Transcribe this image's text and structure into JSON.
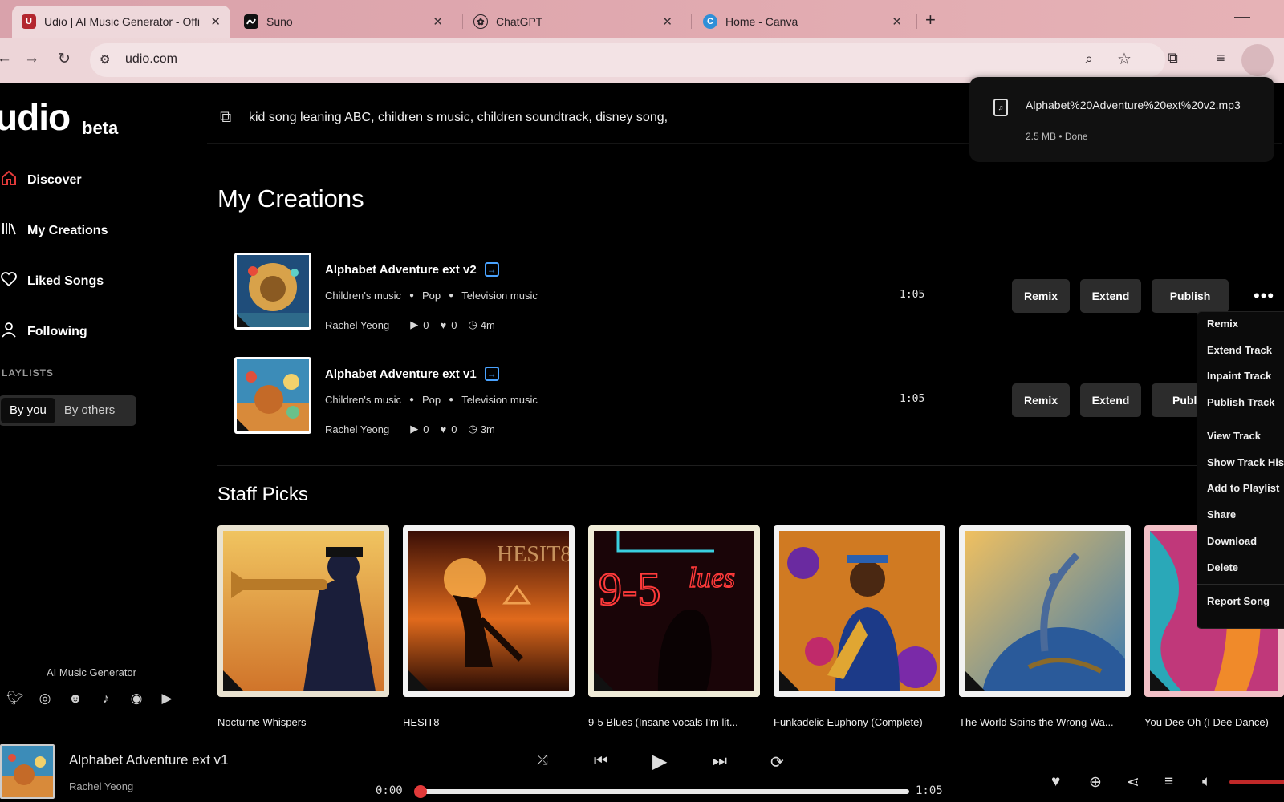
{
  "browser": {
    "tabs": [
      {
        "title": "Udio | AI Music Generator - Offi",
        "active": true,
        "favicon": "udio-icon"
      },
      {
        "title": "Suno",
        "active": false,
        "favicon": "suno-icon"
      },
      {
        "title": "ChatGPT",
        "active": false,
        "favicon": "chatgpt-icon"
      },
      {
        "title": "Home - Canva",
        "active": false,
        "favicon": "canva-icon"
      }
    ],
    "close_glyph": "✕",
    "new_tab_glyph": "+",
    "url": "udio.com"
  },
  "sidebar": {
    "logo": "udio",
    "logo_suffix": "beta",
    "items": [
      {
        "label": "Discover",
        "icon": "home-icon"
      },
      {
        "label": "My Creations",
        "icon": "library-icon"
      },
      {
        "label": "Liked Songs",
        "icon": "heart-icon"
      },
      {
        "label": "Following",
        "icon": "user-icon"
      }
    ],
    "playlists_label": "LAYLISTS",
    "playlist_filters": [
      "By you",
      "By others"
    ],
    "footer_label": "AI Music Generator",
    "socials": [
      "twitter-icon",
      "instagram-icon",
      "discord-icon",
      "tiktok-icon",
      "reddit-icon",
      "youtube-icon"
    ]
  },
  "prompt": {
    "text": "kid song leaning ABC, children s music, children soundtrack, disney song,"
  },
  "my_creations": {
    "heading": "My Creations",
    "tracks": [
      {
        "title": "Alphabet Adventure ext v2",
        "tags": [
          "Children's music",
          "Pop",
          "Television music"
        ],
        "artist": "Rachel Yeong",
        "plays": "0",
        "likes": "0",
        "age": "4m",
        "duration": "1:05"
      },
      {
        "title": "Alphabet Adventure ext v1",
        "tags": [
          "Children's music",
          "Pop",
          "Television music"
        ],
        "artist": "Rachel Yeong",
        "plays": "0",
        "likes": "0",
        "age": "3m",
        "duration": "1:05"
      }
    ],
    "buttons": {
      "remix": "Remix",
      "extend": "Extend",
      "publish": "Publish",
      "publish_clipped": "Publ"
    }
  },
  "staff_picks": {
    "heading": "Staff Picks",
    "items": [
      {
        "title": "Nocturne Whispers"
      },
      {
        "title": "HESIT8"
      },
      {
        "title": "9-5 Blues (Insane vocals I'm lit..."
      },
      {
        "title": "Funkadelic Euphony (Complete)"
      },
      {
        "title": "The World Spins the Wrong Wa..."
      },
      {
        "title": "You Dee Oh (I Dee Dance)"
      }
    ]
  },
  "download": {
    "filename": "Alphabet%20Adventure%20ext%20v2.mp3",
    "status": "2.5 MB • Done"
  },
  "context_menu": {
    "items": [
      "Remix",
      "Extend Track",
      "Inpaint Track",
      "Publish Track",
      "View Track",
      "Show Track His",
      "Add to Playlist",
      "Share",
      "Download",
      "Delete",
      "Report Song"
    ]
  },
  "player": {
    "title": "Alphabet Adventure ext v1",
    "artist": "Rachel Yeong",
    "current_time": "0:00",
    "total_time": "1:05",
    "progress": 0.0
  },
  "colors": {
    "accent": "#e23a3a",
    "link_blue": "#4aa3ff",
    "button_bg": "#2c2c2c"
  }
}
